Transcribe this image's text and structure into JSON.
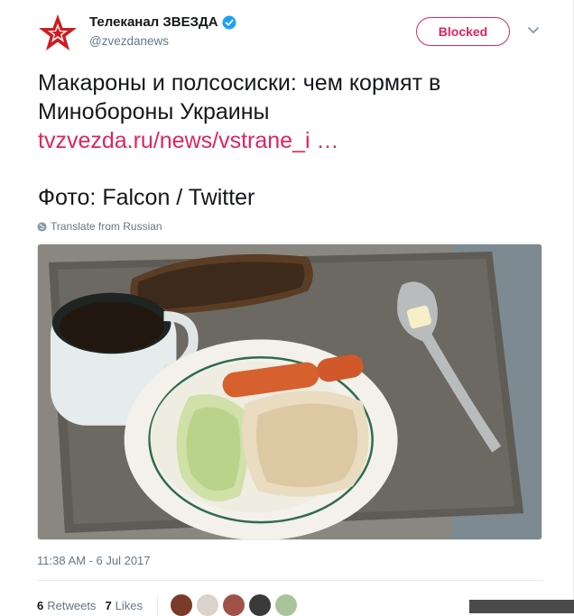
{
  "account": {
    "display_name": "Телеканал ЗВЕЗДА",
    "handle": "@zvezdanews",
    "verified": true
  },
  "header": {
    "blocked_label": "Blocked"
  },
  "tweet": {
    "text_line1": "Макароны и полсосиски: чем кормят в",
    "text_line2": "Минобороны Украины",
    "link_text": "tvzvezda.ru/news/vstrane_i …",
    "photo_credit": "Фото: Falcon / Twitter",
    "translate_label": "Translate from Russian",
    "timestamp": "11:38 AM - 6 Jul 2017"
  },
  "stats": {
    "retweets_count": "6",
    "retweets_label": "Retweets",
    "likes_count": "7",
    "likes_label": "Likes"
  },
  "icons": {
    "logo": "red-star-logo-icon",
    "verified": "verified-badge-icon",
    "menu": "chevron-down-icon",
    "translate": "globe-icon"
  },
  "colors": {
    "accent": "#e0245e",
    "text": "#14171a",
    "muted": "#657786",
    "verified": "#1da1f2"
  }
}
